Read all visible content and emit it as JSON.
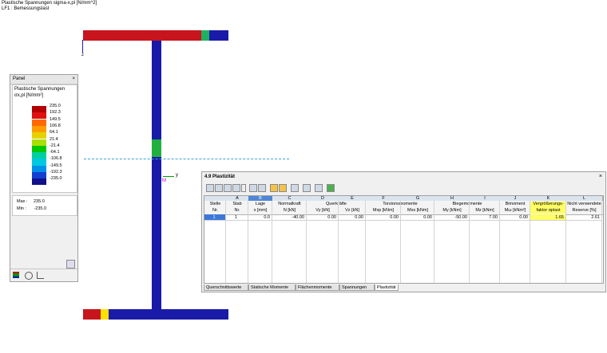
{
  "header": {
    "line1": "Plastische Spannungen sigma-x,pl [N/mm^2]",
    "line2": "LF1 : Bemessungslast"
  },
  "colors": {
    "flange_red": "#c8141c",
    "web_blue": "#1a1aa8",
    "accent_yellow": "#ffff66"
  },
  "axes": {
    "y_label": "y",
    "z_label": "z",
    "m_label": "M"
  },
  "panel": {
    "title": "Panel",
    "close": "×",
    "heading": "Plastische Spannungen",
    "unit": "σx,pl [N/mm²]",
    "legend": [
      {
        "value": "235.0",
        "color": "#b40000"
      },
      {
        "value": "192.3",
        "color": "#e01010"
      },
      {
        "value": "149.5",
        "color": "#ff6a00"
      },
      {
        "value": "106.8",
        "color": "#ff9d00"
      },
      {
        "value": "64.1",
        "color": "#e6d200"
      },
      {
        "value": "21.4",
        "color": "#a8e000"
      },
      {
        "value": "-21.4",
        "color": "#00c800"
      },
      {
        "value": "-64.1",
        "color": "#00d0a0"
      },
      {
        "value": "-106.8",
        "color": "#00c8e0"
      },
      {
        "value": "-149.5",
        "color": "#0090e8"
      },
      {
        "value": "-192.3",
        "color": "#1040d0"
      },
      {
        "value": "-235.0",
        "color": "#10108a"
      }
    ],
    "max_label": "Max :",
    "max_value": "235.0",
    "min_label": "Min :",
    "min_value": "-235.0"
  },
  "dialog": {
    "title": "4.9 Plastizität",
    "close": "×",
    "col_letters": [
      "",
      "A",
      "B",
      "C",
      "D",
      "E",
      "F",
      "G",
      "H",
      "I",
      "J",
      "K",
      "L"
    ],
    "header1": [
      "Stelle",
      "Stab",
      "Lage",
      "Normalkraft",
      "Querkräfte",
      "",
      "Torsionsmomente",
      "",
      "Biegemomente",
      "",
      "Bimoment",
      "Vergrößerungs-",
      "Nicht verwendete"
    ],
    "header2": [
      "Nr.",
      "Nr.",
      "x [mm]",
      "N [kN]",
      "Vy [kN]",
      "Vz [kN]",
      "Mxp [kNm]",
      "Mxs [kNm]",
      "My [kNm]",
      "Mz [kNm]",
      "Mω [kNm²]",
      "faktor αplast",
      "Reserve [%]"
    ],
    "row": [
      "1",
      "1",
      "0.0",
      "-40.00",
      "0.00",
      "0.00",
      "0.00",
      "0.00",
      "-50.00",
      "7.00",
      "0.00",
      "1.65",
      "2.61"
    ],
    "tabs": [
      "Querschnittswerte",
      "Statische Momente",
      "Flächenmomente",
      "Spannungen",
      "Plastizität"
    ]
  }
}
